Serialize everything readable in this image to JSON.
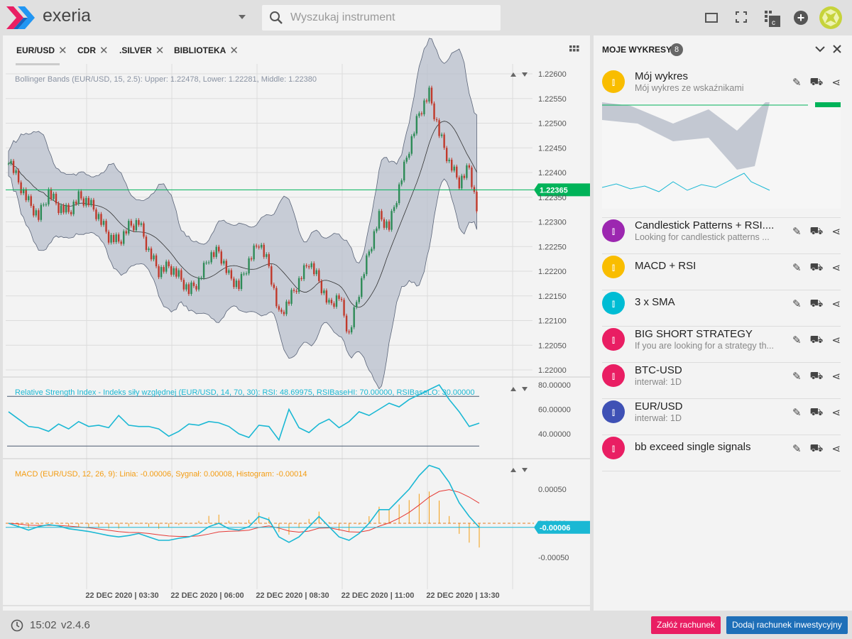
{
  "app": {
    "name": "exeria",
    "search_placeholder": "Wyszukaj instrument"
  },
  "tabs": [
    {
      "label": "EUR/USD"
    },
    {
      "label": "CDR"
    },
    {
      "label": ".SILVER"
    },
    {
      "label": "BIBLIOTEKA"
    }
  ],
  "chart": {
    "bb_label": "Bollinger Bands (EUR/USD, 15, 2.5): Upper: 1.22478, Lower: 1.22281, Middle: 1.22380",
    "rsi_label": "Relative Strength Index - Indeks siły względnej (EUR/USD, 14, 70, 30): RSI: 48.69975, RSIBaseHI: 70.00000, RSIBaseLO: 30.00000",
    "macd_label": "MACD (EUR/USD, 12, 26, 9): Linia: -0.00006, Sygnał: 0.00008, Histogram: -0.00014",
    "price_ticks": [
      "1.22600",
      "1.22550",
      "1.22500",
      "1.22450",
      "1.22400",
      "1.22350",
      "1.22300",
      "1.22250",
      "1.22200",
      "1.22150",
      "1.22100",
      "1.22050",
      "1.22000"
    ],
    "price_range": [
      1.22,
      1.226
    ],
    "current_price": "1.22365",
    "rsi_ticks": [
      "80.00000",
      "60.00000",
      "40.00000"
    ],
    "macd_ticks": [
      "0.00050",
      "0.00000",
      "-0.00050"
    ],
    "macd_current": "-0.00006",
    "time_labels": [
      "22 DEC 2020 | 03:30",
      "22 DEC 2020 | 06:00",
      "22 DEC 2020 | 08:30",
      "22 DEC 2020 | 11:00",
      "22 DEC 2020 | 13:30"
    ],
    "colors": {
      "up": "#2e8b57",
      "down": "#c0392b",
      "band": "#b8bfcc",
      "price_line": "#00b359",
      "rsi": "#1ab8d4",
      "macd": "#1ab8d4",
      "signal": "#e53935",
      "hist": "#f39c12"
    },
    "closes": [
      1.2243,
      1.2238,
      1.2234,
      1.2231,
      1.2236,
      1.2233,
      1.2232,
      1.2235,
      1.2234,
      1.2231,
      1.2227,
      1.2226,
      1.2229,
      1.223,
      1.2224,
      1.222,
      1.2221,
      1.2219,
      1.2216,
      1.2218,
      1.2223,
      1.2224,
      1.2219,
      1.2217,
      1.2222,
      1.2226,
      1.2221,
      1.2211,
      1.2214,
      1.2218,
      1.2222,
      1.2218,
      1.2213,
      1.2215,
      1.2207,
      1.2216,
      1.2224,
      1.2231,
      1.2229,
      1.2237,
      1.2245,
      1.2252,
      1.2256,
      1.2248,
      1.2242,
      1.2238,
      1.2241,
      1.223
    ],
    "rsi": [
      58,
      52,
      46,
      45,
      42,
      48,
      44,
      50,
      46,
      47,
      45,
      55,
      47,
      46,
      46,
      44,
      38,
      42,
      48,
      47,
      50,
      49,
      46,
      40,
      37,
      47,
      46,
      35,
      60,
      45,
      41,
      48,
      52,
      45,
      50,
      58,
      55,
      60,
      65,
      62,
      68,
      72,
      76,
      80,
      68,
      58,
      46,
      48.7
    ],
    "macd": [
      0,
      -5e-05,
      -0.0001,
      -5e-05,
      -2e-05,
      -4e-05,
      -8e-05,
      -0.0001,
      -0.00012,
      -0.00015,
      -0.00018,
      -0.0002,
      -0.00018,
      -0.00015,
      -0.0002,
      -0.00025,
      -0.00025,
      -0.00022,
      -0.0002,
      -0.00015,
      -5e-05,
      0,
      -8e-05,
      -0.0001,
      -5e-05,
      0.0001,
      5e-05,
      -0.0002,
      -0.00028,
      -0.0002,
      -5e-05,
      0.0001,
      -5e-05,
      -0.0002,
      -0.00025,
      -0.00015,
      0,
      0.0002,
      0.0002,
      0.00035,
      0.0005,
      0.0007,
      0.00085,
      0.0008,
      0.0006,
      0.0003,
      0.0001,
      -6e-05
    ]
  },
  "side": {
    "title": "MOJE WYKRESY",
    "count": "8",
    "items": [
      {
        "title": "Mój wykres",
        "subtitle": "Mój wykres ze wskaźnikami",
        "color": "#f9bd00"
      },
      {
        "title": "Candlestick Patterns + RSI....",
        "subtitle": "Looking for candlestick patterns ...",
        "color": "#9c27b0"
      },
      {
        "title": "MACD + RSI",
        "subtitle": "",
        "color": "#f9bd00"
      },
      {
        "title": "3 x SMA",
        "subtitle": "",
        "color": "#00bcd4"
      },
      {
        "title": "BIG SHORT STRATEGY",
        "subtitle": "If you are looking for a strategy th...",
        "color": "#e91e63"
      },
      {
        "title": "BTC-USD",
        "subtitle": "interwał: 1D",
        "color": "#e91e63"
      },
      {
        "title": "EUR/USD",
        "subtitle": "interwał: 1D",
        "color": "#3f51b5"
      },
      {
        "title": "bb exceed single signals",
        "subtitle": "",
        "color": "#e91e63"
      }
    ]
  },
  "footer": {
    "time": "15:02",
    "version": "v2.4.6",
    "open_account": "Załóż rachunek",
    "add_account": "Dodaj rachunek inwestycyjny"
  }
}
